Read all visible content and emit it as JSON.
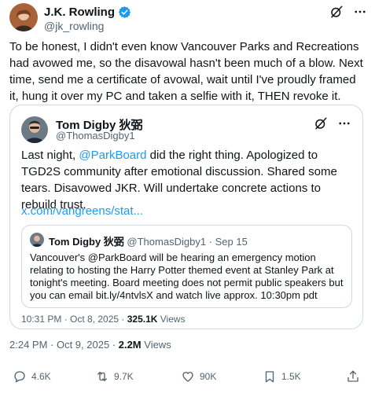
{
  "author": {
    "name": "J.K. Rowling",
    "handle": "@jk_rowling",
    "verified_icon": "verified-badge-icon",
    "accent": "#1d9bf0"
  },
  "tweet": {
    "text": "To be honest, I didn't even know Vancouver Parks and Recreations had avowed me, so the disavowal hasn't been much of a blow. Next time, send me a certificate of avowal, wait until I've proudly framed it, hung it over my PC and taken a selfie with it, THEN revoke it.",
    "time": "2:24 PM · Oct 9, 2025 · ",
    "views_count": "2.2M",
    "views_label": " Views"
  },
  "quote": {
    "name": "Tom Digby 狄弼",
    "handle": "@ThomasDigby1",
    "text_before": "Last night, ",
    "mention": "@ParkBoard",
    "text_after": " did the right thing.  Apologized to TGD2S community after emotional discussion.  Shared some tears.  Disavowed JKR. Will undertake concrete actions to rebuild trust.",
    "link": "x.com/vangreens/stat...",
    "time": "10:31 PM · Oct 8, 2025 · ",
    "views_count": "325.1K",
    "views_label": " Views"
  },
  "nested_quote": {
    "name": "Tom Digby 狄弼",
    "handle_date": " @ThomasDigby1 · Sep 15",
    "text": "Vancouver's @ParkBoard will be hearing an emergency motion relating to hosting the Harry Potter themed event at Stanley Park at tonight's meeting. Board meeting does not permit public speakers but you can email bit.ly/4ntvlsX and watch live approx. 10:30pm pdt"
  },
  "engagement": {
    "replies": "4.6K",
    "reposts": "9.7K",
    "likes": "90K",
    "bookmarks": "1.5K"
  },
  "icons": [
    "grok-icon",
    "more-icon",
    "reply-icon",
    "repost-icon",
    "like-icon",
    "bookmark-icon",
    "share-icon"
  ]
}
